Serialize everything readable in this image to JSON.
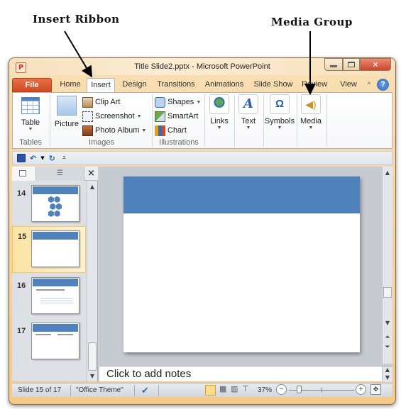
{
  "annotations": {
    "insert_ribbon": "Insert Ribbon",
    "media_group": "Media Group"
  },
  "window": {
    "title": "Title Slide2.pptx  -  Microsoft PowerPoint",
    "app_icon": "P",
    "controls": {
      "minimize": "—",
      "maximize": "▢",
      "close": "✕"
    }
  },
  "tabs": [
    {
      "label": "File"
    },
    {
      "label": "Home"
    },
    {
      "label": "Insert",
      "active": true
    },
    {
      "label": "Design"
    },
    {
      "label": "Transitions"
    },
    {
      "label": "Animations"
    },
    {
      "label": "Slide Show"
    },
    {
      "label": "Review"
    },
    {
      "label": "View"
    }
  ],
  "ribbon": {
    "groups": {
      "tables": {
        "label": "Tables",
        "table": "Table"
      },
      "images": {
        "label": "Images",
        "picture": "Picture",
        "clip_art": "Clip Art",
        "screenshot": "Screenshot",
        "photo_album": "Photo Album"
      },
      "illustrations": {
        "label": "Illustrations",
        "shapes": "Shapes",
        "smartart": "SmartArt",
        "chart": "Chart"
      },
      "links": {
        "label": "Links"
      },
      "text": {
        "label": "Text"
      },
      "symbols": {
        "label": "Symbols"
      },
      "media": {
        "label": "Media"
      }
    },
    "collapse_icon": "^",
    "help_icon": "?"
  },
  "slides_pane": {
    "close": "×",
    "thumbnails": [
      {
        "number": "14"
      },
      {
        "number": "15",
        "selected": true
      },
      {
        "number": "16"
      },
      {
        "number": "17"
      }
    ]
  },
  "notes": {
    "placeholder": "Click to add notes"
  },
  "statusbar": {
    "slide_info": "Slide 15 of 17",
    "theme": "\"Office Theme\"",
    "zoom": "37%",
    "zoom_fraction": 0.37
  }
}
